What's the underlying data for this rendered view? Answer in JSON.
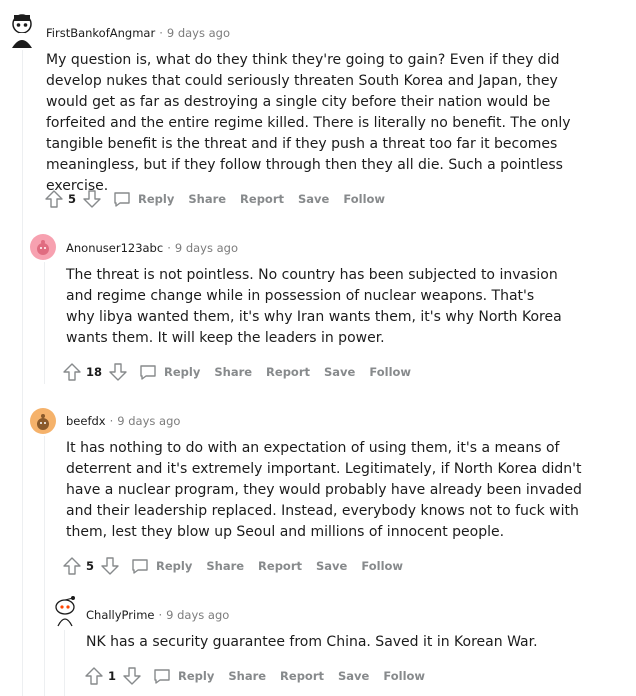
{
  "comments": [
    {
      "author": "FirstBankofAngmar",
      "separator": "·",
      "time": "9 days ago",
      "text": "My question is, what do they think they're going to gain? Even if they did develop nukes that could seriously threaten South Korea and Japan, they would get as far as destroying a single city before their nation would be forfeited and the entire regime killed. There is literally no benefit. The only tangible benefit is the threat and if they push a threat too far it becomes meaningless, but if they follow through then they all die. Such a pointless exercise.",
      "score": "5",
      "avatar_icon": "snoo-avatar-icon"
    },
    {
      "author": "Anonuser123abc",
      "separator": "·",
      "time": "9 days ago",
      "text": "The threat is not pointless. No country has been subjected to invasion and regime change while in possession of nuclear weapons. That's why libya wanted them, it's why Iran wants them, it's why North Korea wants them. It will keep the leaders in power.",
      "score": "18",
      "avatar_icon": "pink-snoo-avatar-icon"
    },
    {
      "author": "beefdx",
      "separator": "·",
      "time": "9 days ago",
      "text": "It has nothing to do with an expectation of using them, it's a means of deterrent and it's extremely important. Legitimately, if North Korea didn't have a nuclear program, they would probably have already been invaded and their leadership replaced. Instead, everybody knows not to fuck with them, lest they blow up Seoul and millions of innocent people.",
      "score": "5",
      "avatar_icon": "orange-snoo-avatar-icon"
    },
    {
      "author": "ChallyPrime",
      "separator": "·",
      "time": "9 days ago",
      "text": "NK has a security guarantee from China. Saved it in Korean War.",
      "score": "1",
      "avatar_icon": "snoo-avatar-icon"
    }
  ],
  "actions": {
    "reply": "Reply",
    "share": "Share",
    "report": "Report",
    "save": "Save",
    "follow": "Follow"
  },
  "colors": {
    "meta_text": "#7c7c7c",
    "action_text": "#878a8c",
    "thread_line": "#edeff1",
    "body_text": "#1c1c1c"
  }
}
